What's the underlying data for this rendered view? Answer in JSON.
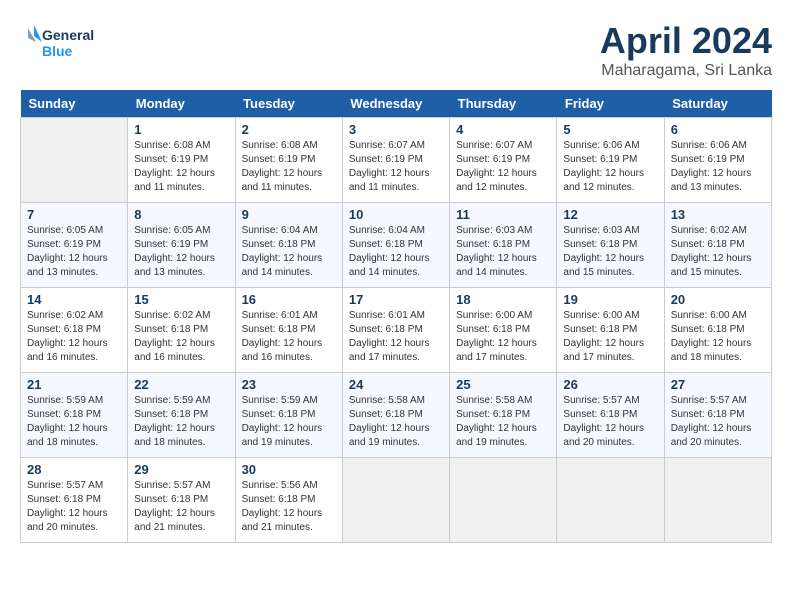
{
  "header": {
    "logo_line1": "General",
    "logo_line2": "Blue",
    "month": "April 2024",
    "location": "Maharagama, Sri Lanka"
  },
  "weekdays": [
    "Sunday",
    "Monday",
    "Tuesday",
    "Wednesday",
    "Thursday",
    "Friday",
    "Saturday"
  ],
  "weeks": [
    [
      {
        "num": "",
        "info": ""
      },
      {
        "num": "1",
        "info": "Sunrise: 6:08 AM\nSunset: 6:19 PM\nDaylight: 12 hours\nand 11 minutes."
      },
      {
        "num": "2",
        "info": "Sunrise: 6:08 AM\nSunset: 6:19 PM\nDaylight: 12 hours\nand 11 minutes."
      },
      {
        "num": "3",
        "info": "Sunrise: 6:07 AM\nSunset: 6:19 PM\nDaylight: 12 hours\nand 11 minutes."
      },
      {
        "num": "4",
        "info": "Sunrise: 6:07 AM\nSunset: 6:19 PM\nDaylight: 12 hours\nand 12 minutes."
      },
      {
        "num": "5",
        "info": "Sunrise: 6:06 AM\nSunset: 6:19 PM\nDaylight: 12 hours\nand 12 minutes."
      },
      {
        "num": "6",
        "info": "Sunrise: 6:06 AM\nSunset: 6:19 PM\nDaylight: 12 hours\nand 13 minutes."
      }
    ],
    [
      {
        "num": "7",
        "info": "Sunrise: 6:05 AM\nSunset: 6:19 PM\nDaylight: 12 hours\nand 13 minutes."
      },
      {
        "num": "8",
        "info": "Sunrise: 6:05 AM\nSunset: 6:19 PM\nDaylight: 12 hours\nand 13 minutes."
      },
      {
        "num": "9",
        "info": "Sunrise: 6:04 AM\nSunset: 6:18 PM\nDaylight: 12 hours\nand 14 minutes."
      },
      {
        "num": "10",
        "info": "Sunrise: 6:04 AM\nSunset: 6:18 PM\nDaylight: 12 hours\nand 14 minutes."
      },
      {
        "num": "11",
        "info": "Sunrise: 6:03 AM\nSunset: 6:18 PM\nDaylight: 12 hours\nand 14 minutes."
      },
      {
        "num": "12",
        "info": "Sunrise: 6:03 AM\nSunset: 6:18 PM\nDaylight: 12 hours\nand 15 minutes."
      },
      {
        "num": "13",
        "info": "Sunrise: 6:02 AM\nSunset: 6:18 PM\nDaylight: 12 hours\nand 15 minutes."
      }
    ],
    [
      {
        "num": "14",
        "info": "Sunrise: 6:02 AM\nSunset: 6:18 PM\nDaylight: 12 hours\nand 16 minutes."
      },
      {
        "num": "15",
        "info": "Sunrise: 6:02 AM\nSunset: 6:18 PM\nDaylight: 12 hours\nand 16 minutes."
      },
      {
        "num": "16",
        "info": "Sunrise: 6:01 AM\nSunset: 6:18 PM\nDaylight: 12 hours\nand 16 minutes."
      },
      {
        "num": "17",
        "info": "Sunrise: 6:01 AM\nSunset: 6:18 PM\nDaylight: 12 hours\nand 17 minutes."
      },
      {
        "num": "18",
        "info": "Sunrise: 6:00 AM\nSunset: 6:18 PM\nDaylight: 12 hours\nand 17 minutes."
      },
      {
        "num": "19",
        "info": "Sunrise: 6:00 AM\nSunset: 6:18 PM\nDaylight: 12 hours\nand 17 minutes."
      },
      {
        "num": "20",
        "info": "Sunrise: 6:00 AM\nSunset: 6:18 PM\nDaylight: 12 hours\nand 18 minutes."
      }
    ],
    [
      {
        "num": "21",
        "info": "Sunrise: 5:59 AM\nSunset: 6:18 PM\nDaylight: 12 hours\nand 18 minutes."
      },
      {
        "num": "22",
        "info": "Sunrise: 5:59 AM\nSunset: 6:18 PM\nDaylight: 12 hours\nand 18 minutes."
      },
      {
        "num": "23",
        "info": "Sunrise: 5:59 AM\nSunset: 6:18 PM\nDaylight: 12 hours\nand 19 minutes."
      },
      {
        "num": "24",
        "info": "Sunrise: 5:58 AM\nSunset: 6:18 PM\nDaylight: 12 hours\nand 19 minutes."
      },
      {
        "num": "25",
        "info": "Sunrise: 5:58 AM\nSunset: 6:18 PM\nDaylight: 12 hours\nand 19 minutes."
      },
      {
        "num": "26",
        "info": "Sunrise: 5:57 AM\nSunset: 6:18 PM\nDaylight: 12 hours\nand 20 minutes."
      },
      {
        "num": "27",
        "info": "Sunrise: 5:57 AM\nSunset: 6:18 PM\nDaylight: 12 hours\nand 20 minutes."
      }
    ],
    [
      {
        "num": "28",
        "info": "Sunrise: 5:57 AM\nSunset: 6:18 PM\nDaylight: 12 hours\nand 20 minutes."
      },
      {
        "num": "29",
        "info": "Sunrise: 5:57 AM\nSunset: 6:18 PM\nDaylight: 12 hours\nand 21 minutes."
      },
      {
        "num": "30",
        "info": "Sunrise: 5:56 AM\nSunset: 6:18 PM\nDaylight: 12 hours\nand 21 minutes."
      },
      {
        "num": "",
        "info": ""
      },
      {
        "num": "",
        "info": ""
      },
      {
        "num": "",
        "info": ""
      },
      {
        "num": "",
        "info": ""
      }
    ]
  ]
}
